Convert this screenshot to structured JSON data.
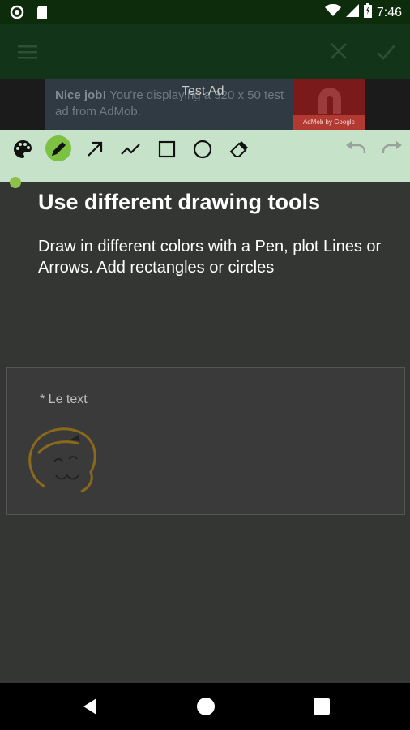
{
  "status_bar": {
    "time": "7:46",
    "icons": [
      "circle-icon",
      "sd-card-icon",
      "wifi-icon",
      "signal-icon",
      "battery-icon"
    ]
  },
  "app_bar": {
    "left_icon": "menu-icon",
    "right_icons": [
      "close-icon",
      "check-icon"
    ]
  },
  "ad": {
    "title": "Test Ad",
    "body_bold": "Nice job!",
    "body": " You're displaying a 320 x 50 test ad from AdMob.",
    "badge": "AdMob by Google"
  },
  "toolbar": {
    "tools": [
      "palette-icon",
      "pen-icon",
      "arrow-icon",
      "line-icon",
      "rectangle-icon",
      "circle-icon",
      "eraser-icon"
    ],
    "history": [
      "undo-icon",
      "redo-icon"
    ],
    "active_tool": "pen-icon",
    "accent": "#7cc142"
  },
  "content": {
    "title": "Use different drawing tools",
    "description": "Draw in different colors with a Pen, plot Lines or Arrows. Add rectangles or circles"
  },
  "preview": {
    "note": "* Le text"
  },
  "nav_bar": {
    "buttons": [
      "back-icon",
      "home-icon",
      "recents-icon"
    ]
  },
  "colors": {
    "background": "#333632",
    "app_bar": "#12351a",
    "status_bar": "#0c2c0c",
    "toolbar": "#c6e3c9"
  }
}
